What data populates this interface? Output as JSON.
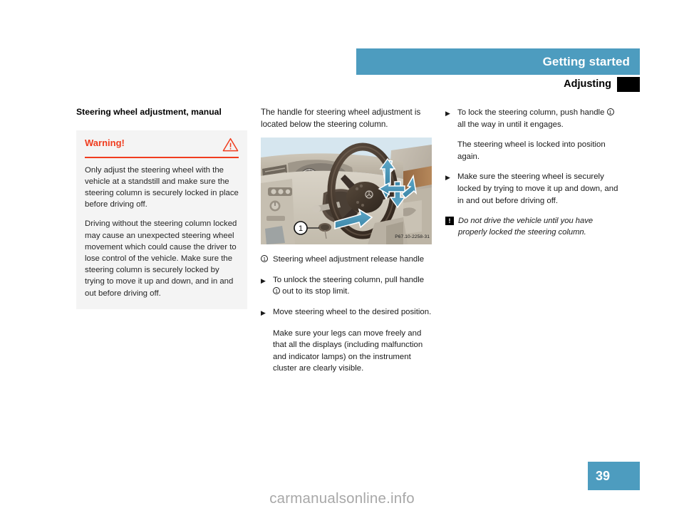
{
  "header": {
    "chapter_title": "Getting started",
    "section_title": "Adjusting",
    "tab_marker": "chapter-tab"
  },
  "left_column": {
    "heading": "Steering wheel adjustment, manual",
    "warning": {
      "label": "Warning!",
      "icon": "warning-triangle-icon",
      "accent_color": "#f03c1e",
      "background_color": "#f4f4f4",
      "paragraphs": [
        "Only adjust the steering wheel with the vehicle at a standstill and make sure the steering column is securely locked in place before driving off.",
        "Driving without the steering column locked may cause an unexpected steering wheel movement which could cause the driver to lose control of the vehicle. Make sure the steering column is securely locked by trying to move it up and down, and in and out before driving off."
      ]
    }
  },
  "middle_column": {
    "intro": "The handle for steering wheel adjustment is located below the steering column.",
    "figure": {
      "code": "P67.10-2258-31",
      "callout_number": "1",
      "alt": "Vehicle interior showing steering wheel, instrument cluster and adjustment release handle with movement arrows"
    },
    "caption": {
      "number": "1",
      "text": "Steering wheel adjustment release handle"
    },
    "items": [
      {
        "marker": "▶",
        "text_before": "To unlock the steering column, pull handle ",
        "ref": "1",
        "text_after": " out to its stop limit."
      },
      {
        "marker": "▶",
        "text_before": "Move steering wheel to the desired position.",
        "ref": "",
        "text_after": ""
      }
    ],
    "indent_note": "Make sure your legs can move freely and that all the displays (including malfunction and indicator lamps) on the instrument cluster are clearly visible."
  },
  "right_column": {
    "items": [
      {
        "marker": "▶",
        "text_before": "To lock the steering column, push handle ",
        "ref": "1",
        "text_after": " all the way in until it engages."
      },
      {
        "marker": "▶",
        "text_before": "Make sure the steering wheel is securely locked by trying to move it up and down, and in and out before driving off.",
        "ref": "",
        "text_after": ""
      }
    ],
    "indent_note": "The steering wheel is locked into position again.",
    "note": {
      "icon": "exclamation-box-icon",
      "text": "Do not drive the vehicle until you have properly locked the steering column."
    }
  },
  "footer": {
    "page_number": "39",
    "watermark": "carmanualsonline.info",
    "badge_color": "#4d9cbf"
  }
}
